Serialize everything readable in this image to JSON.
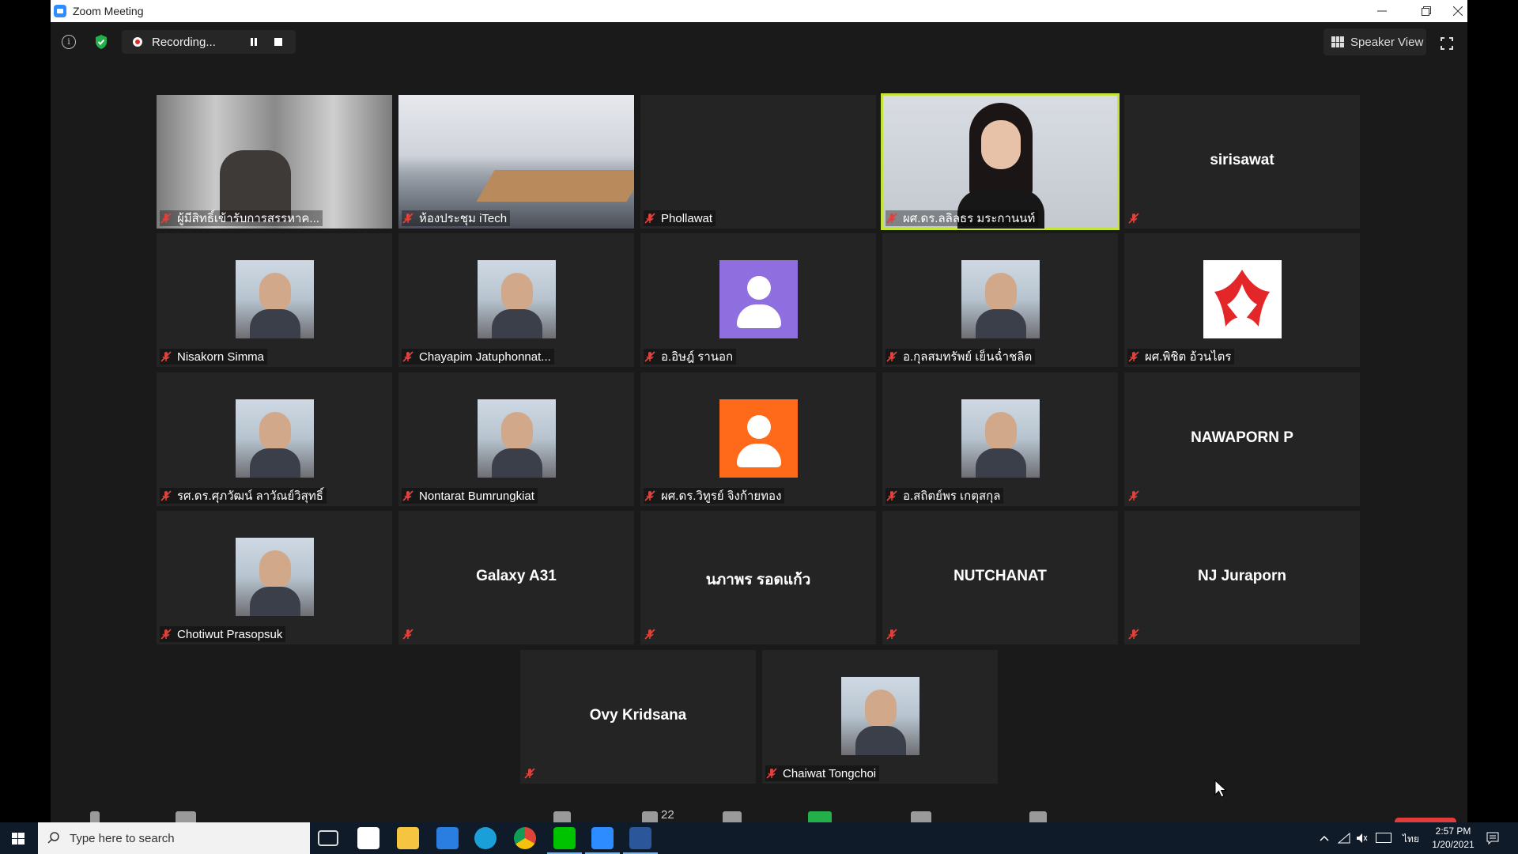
{
  "window": {
    "title": "Zoom Meeting"
  },
  "topbar": {
    "recording_label": "Recording...",
    "speaker_view_label": "Speaker View"
  },
  "tiles": [
    {
      "label": "ผู้มีสิทธิ์เข้ารับการสรรหาค...",
      "type": "video-chair"
    },
    {
      "label": "ห้องประชุม iTech",
      "type": "video-room"
    },
    {
      "label": "Phollawat",
      "type": "blank"
    },
    {
      "label": "ผศ.ดร.ลลิลธร  มระกานนท์",
      "type": "video-speaker",
      "active": true
    },
    {
      "label": "",
      "name": "sirisawat",
      "type": "name"
    },
    {
      "label": "Nisakorn Simma",
      "type": "photo"
    },
    {
      "label": "Chayapim Jatuphonnat...",
      "type": "photo"
    },
    {
      "label": "อ.อิษฎ์ รานอก",
      "type": "default-avatar",
      "color": "#8f6fe0"
    },
    {
      "label": "อ.กุลสมทรัพย์ เย็นฉ่ำชลิต",
      "type": "photo"
    },
    {
      "label": "ผศ.พิชิต อ้วนไตร",
      "type": "logo"
    },
    {
      "label": "รศ.ดร.ศุภวัฒน์ ลาวัณย์วิสุทธิ์",
      "type": "photo"
    },
    {
      "label": "Nontarat Bumrungkiat",
      "type": "photo"
    },
    {
      "label": "ผศ.ดร.วิทูรย์ จิงก้ายทอง",
      "type": "default-avatar",
      "color": "#ff6a1a"
    },
    {
      "label": "อ.สถิตย์พร เกตุสกุล",
      "type": "photo"
    },
    {
      "label": "",
      "name": "NAWAPORN P",
      "type": "name"
    },
    {
      "label": "Chotiwut Prasopsuk",
      "type": "photo"
    },
    {
      "label": "",
      "name": "Galaxy A31",
      "type": "name"
    },
    {
      "label": "",
      "name": "นภาพร  รอดแก้ว",
      "type": "name"
    },
    {
      "label": "",
      "name": "NUTCHANAT",
      "type": "name"
    },
    {
      "label": "",
      "name": "NJ Juraporn",
      "type": "name"
    },
    {
      "label": "",
      "name": "Ovy Kridsana",
      "type": "name"
    },
    {
      "label": "Chaiwat Tongchoi",
      "type": "photo"
    }
  ],
  "toolbar": {
    "participants_count": "22"
  },
  "taskbar": {
    "search_placeholder": "Type here to search",
    "time": "2:57 PM",
    "date": "1/20/2021",
    "language": "ไทย"
  },
  "colors": {
    "active_speaker_border": "#c4e538",
    "muted_mic": "#e0413a",
    "tile_bg": "#242424"
  }
}
